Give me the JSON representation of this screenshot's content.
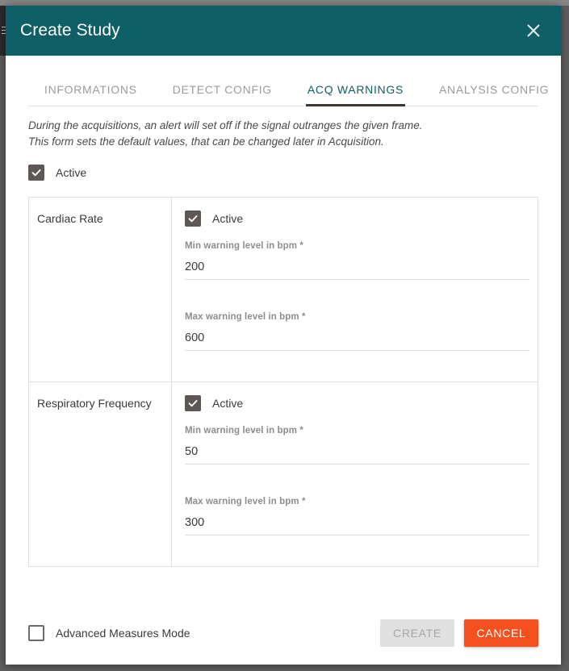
{
  "window": {
    "title": "Create Study",
    "close_icon": "close-icon"
  },
  "tabs": [
    {
      "label": "INFORMATIONS",
      "active": false
    },
    {
      "label": "DETECT CONFIG",
      "active": false
    },
    {
      "label": "ACQ WARNINGS",
      "active": true
    },
    {
      "label": "ANALYSIS CONFIG",
      "active": false
    }
  ],
  "description": {
    "line1": "During the acquisitions, an alert will set off if the signal outranges the given frame.",
    "line2": "This form sets the default values, that can be changed later in Acquisition."
  },
  "master_active": {
    "label": "Active",
    "checked": true
  },
  "warnings": [
    {
      "name": "Cardiac Rate",
      "active": {
        "label": "Active",
        "checked": true
      },
      "min": {
        "label": "Min warning level in bpm *",
        "value": "200"
      },
      "max": {
        "label": "Max warning level in bpm *",
        "value": "600"
      }
    },
    {
      "name": "Respiratory Frequency",
      "active": {
        "label": "Active",
        "checked": true
      },
      "min": {
        "label": "Min warning level in bpm *",
        "value": "50"
      },
      "max": {
        "label": "Max warning level in bpm *",
        "value": "300"
      }
    }
  ],
  "footer": {
    "advanced_mode": {
      "label": "Advanced Measures Mode",
      "checked": false
    },
    "create_label": "CREATE",
    "cancel_label": "CANCEL"
  },
  "colors": {
    "header_teal": "#0f5f66",
    "active_tab": "#0f5f66",
    "tab_underline": "#3c3632",
    "checkbox_fill": "#5d5855",
    "cancel_orange": "#f4511e",
    "create_disabled": "#e0e0e0",
    "backdrop": "#5e5e5e"
  }
}
